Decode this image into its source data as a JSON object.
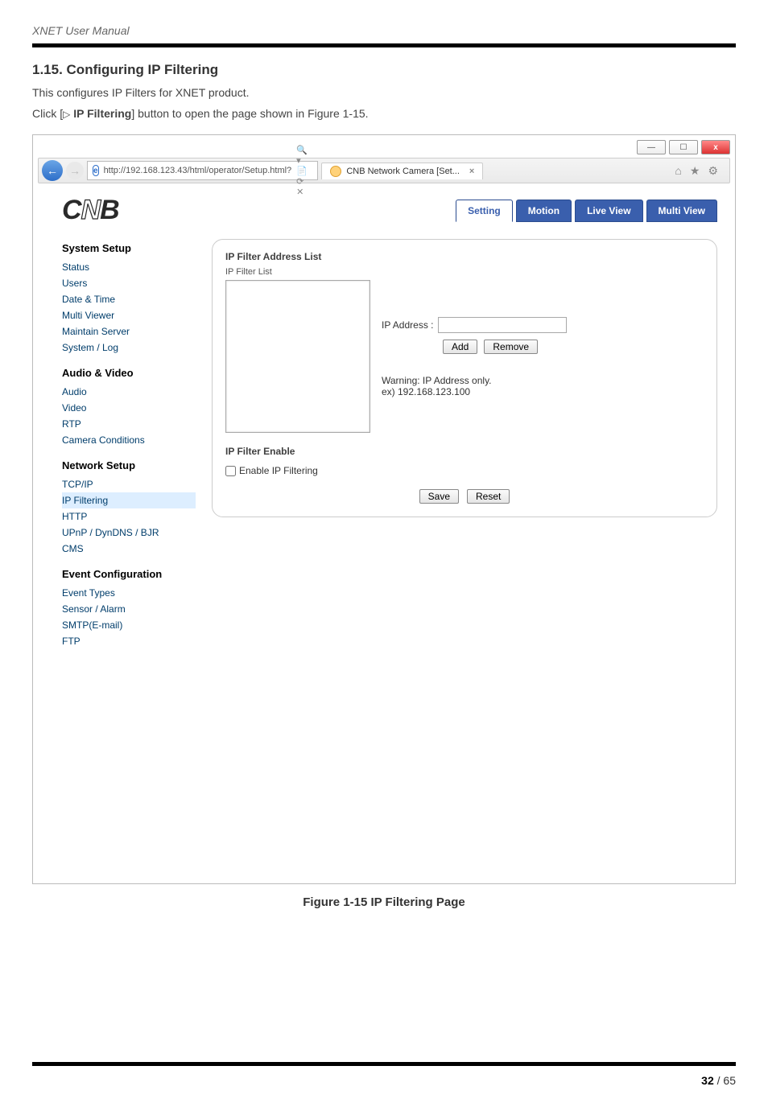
{
  "doc": {
    "header": "XNET User Manual",
    "section_title": "1.15. Configuring IP Filtering",
    "intro": "This configures IP Filters for XNET product.",
    "click_prefix": "Click [",
    "click_btn": " IP Filtering",
    "click_suffix": "] button to open the page shown in Figure 1-15.",
    "figure_caption": "Figure 1-15 IP Filtering Page",
    "page_current": "32",
    "page_sep": " / ",
    "page_total": "65"
  },
  "window": {
    "min": "—",
    "max": "☐",
    "close": "x"
  },
  "browser": {
    "back": "←",
    "fwd": "→",
    "url": "http://192.168.123.43/html/operator/Setup.html?",
    "url_suffix_icons": "🔍 ▾  📄 ⟳ ✕",
    "tab_title": "CNB Network Camera [Set...",
    "tab_close": "×",
    "tool_home": "⌂",
    "tool_star": "★",
    "tool_gear": "⚙"
  },
  "app": {
    "logo_a": "C",
    "logo_b": "N",
    "logo_c": "B",
    "tabs": {
      "setting": "Setting",
      "motion": "Motion",
      "liveview": "Live View",
      "multiview": "Multi View"
    }
  },
  "sidebar": {
    "groups": [
      {
        "title": "System Setup",
        "items": [
          "Status",
          "Users",
          "Date & Time",
          "Multi Viewer",
          "Maintain Server",
          "System / Log"
        ]
      },
      {
        "title": "Audio & Video",
        "items": [
          "Audio",
          "Video",
          "RTP",
          "Camera Conditions"
        ]
      },
      {
        "title": "Network Setup",
        "items": [
          "TCP/IP",
          "IP Filtering",
          "HTTP",
          "UPnP / DynDNS / BJR",
          "CMS"
        ]
      },
      {
        "title": "Event Configuration",
        "items": [
          "Event Types",
          "Sensor / Alarm",
          "SMTP(E-mail)",
          "FTP"
        ]
      }
    ],
    "selected": "IP Filtering"
  },
  "panel": {
    "addr_list_label": "IP Filter Address List",
    "filter_list_label": "IP Filter List",
    "ip_label": "IP Address :",
    "add": "Add",
    "remove": "Remove",
    "warn1": "Warning: IP Address only.",
    "warn2": "ex) 192.168.123.100",
    "enable_label": "IP Filter Enable",
    "chk_label": "Enable IP Filtering",
    "save": "Save",
    "reset": "Reset"
  }
}
